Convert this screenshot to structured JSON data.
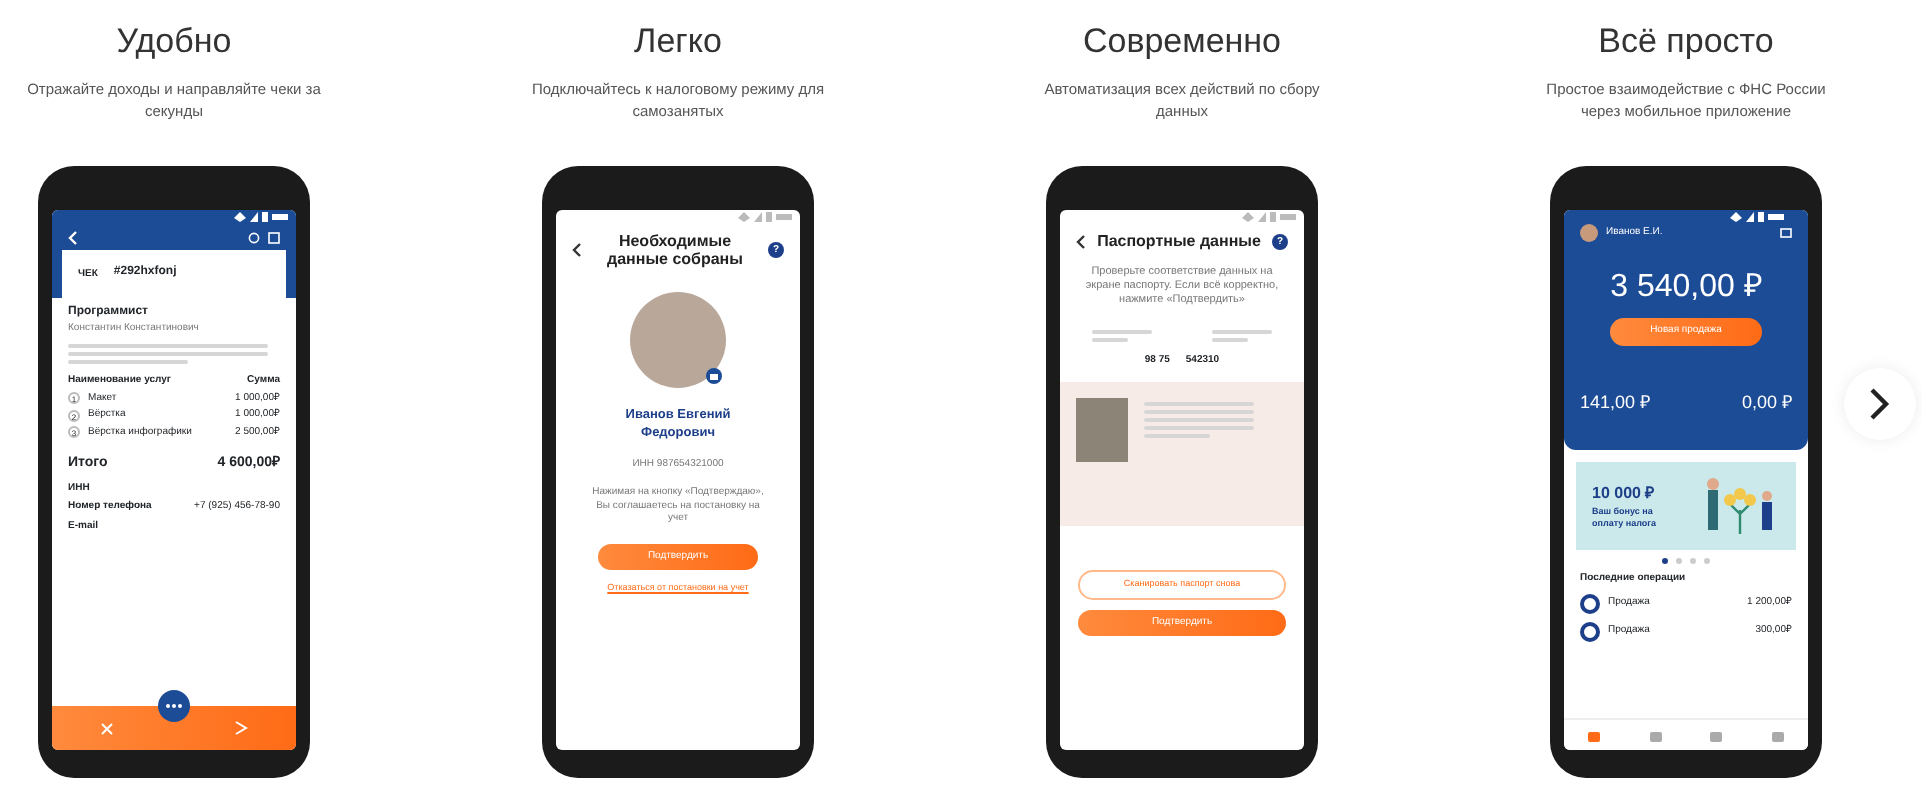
{
  "slides": [
    {
      "title": "Удобно",
      "subtitle": "Отражайте доходы и направляйте чеки за секунды",
      "screen": {
        "kind": "receipt",
        "receipt_label": "ЧЕК",
        "receipt_number": "#292hxfonj",
        "profession": "Программист",
        "client": "Константин Константинович",
        "table_header": [
          "Наименование услуг",
          "Сумма"
        ],
        "items": [
          {
            "index": "1",
            "name": "Макет",
            "amount": "1 000,00₽"
          },
          {
            "index": "2",
            "name": "Вёрстка",
            "amount": "1 000,00₽"
          },
          {
            "index": "3",
            "name": "Вёрстка инфографики",
            "amount": "2 500,00₽"
          }
        ],
        "total_label": "Итого",
        "total": "4 600,00₽",
        "fields": [
          {
            "label": "ИНН"
          },
          {
            "label": "Номер телефона",
            "value": "+7 (925) 456-78-90"
          },
          {
            "label": "E-mail"
          }
        ]
      }
    },
    {
      "title": "Легко",
      "subtitle": "Подключайтесь к налоговому режиму для самозанятых",
      "screen": {
        "kind": "confirm",
        "heading": "Необходимые данные собраны",
        "help": "?",
        "person": "Иванов Евгений Федорович",
        "inn": "ИНН 987654321000",
        "note": "Нажимая на кнопку «Подтверждаю», Вы соглашаетесь на постановку на учет",
        "button": "Подтвердить",
        "link": "Отказаться от постановки на учет"
      }
    },
    {
      "title": "Современно",
      "subtitle": "Автоматизация всех действий по сбору данных",
      "screen": {
        "kind": "passport",
        "heading": "Паспортные данные",
        "help": "?",
        "instruction": "Проверьте соответствие данных на экране паспорту. Если всё корректно, нажмите «Подтвердить»",
        "series": "98 75",
        "number": "542310",
        "secondary_button": "Сканировать паспорт снова",
        "button": "Подтвердить"
      }
    },
    {
      "title": "Всё просто",
      "subtitle": "Простое взаимодействие с ФНС России через мобильное приложение",
      "screen": {
        "kind": "dashboard",
        "user": "Иванов Е.И.",
        "balance": "3 540,00 ₽",
        "button": "Новая продажа",
        "amounts": [
          "141,00 ₽",
          "0,00 ₽"
        ],
        "banner_amount": "10 000 ₽",
        "banner_text": "Ваш бонус на оплату налога",
        "dots": [
          {
            "selected": true
          },
          {
            "selected": false
          },
          {
            "selected": false
          },
          {
            "selected": false
          }
        ],
        "ops_heading": "Последние операции",
        "operations": [
          {
            "name": "Продажа",
            "amount": "1 200,00₽"
          },
          {
            "name": "Продажа",
            "amount": "300,00₽"
          }
        ],
        "nav": [
          {
            "selected": true
          },
          {
            "selected": false
          },
          {
            "selected": false
          },
          {
            "selected": false
          }
        ]
      }
    }
  ]
}
